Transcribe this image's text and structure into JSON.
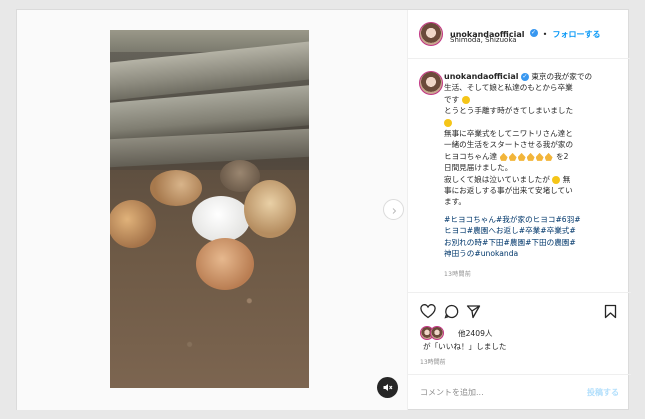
{
  "post": {
    "username": "unokandaofficial",
    "location": "Shimoda, Shizuoka",
    "dot": "•",
    "follow_label": "フォローする",
    "caption_lines": [
      "東京の我が家での",
      "生活、そして娘と私達のもとから卒業",
      "です",
      "とうとう手離す時がきてしまいました",
      "無事に卒業式をしてニワトリさん達と",
      "一緒の生活をスタートさせる我が家の",
      "ヒヨコちゃん達",
      "を2",
      "日間見届けました。",
      "寂しくて娘は泣いていましたが",
      "無",
      "事にお返しする事が出来て安堵してい",
      "ます。"
    ],
    "hashtag_lines": [
      "#ヒヨコちゃん#我が家のヒヨコ#6羽#",
      "ヒヨコ#農園へお返し#卒業#卒業式#",
      "お別れの時#下田#農園#下田の農園#",
      "神田うの#unokanda"
    ],
    "caption_age": "13時間前",
    "likes_text": "他2409人",
    "likes_suffix": "が「いいね！」しました",
    "post_age": "13時間前",
    "comment_placeholder": "コメントを追加...",
    "post_button": "投稿する"
  },
  "icons": {
    "like": "heart-icon",
    "comment": "comment-icon",
    "share": "paper-plane-icon",
    "save": "bookmark-icon",
    "mute": "speaker-muted-icon",
    "next": "chevron-right-icon",
    "verified": "verified-badge-icon"
  },
  "colors": {
    "link_blue": "#0095f6",
    "hashtag": "#00376b",
    "muted_text": "#8e8e8e"
  }
}
